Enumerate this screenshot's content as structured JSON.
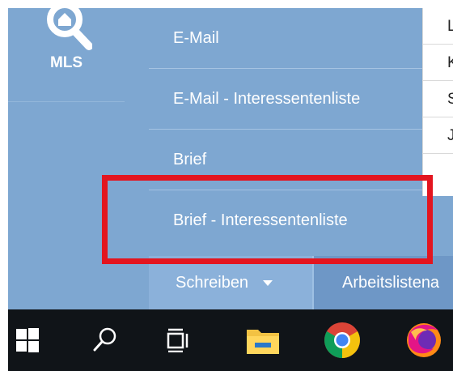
{
  "sidebar": {
    "mls_label": "MLS",
    "mls_icon": "search-home-icon"
  },
  "dropdown": {
    "items": [
      {
        "label": "E-Mail"
      },
      {
        "label": "E-Mail - Interessentenliste"
      },
      {
        "label": "Brief"
      },
      {
        "label": "Brief - Interessentenliste",
        "highlighted": true
      }
    ]
  },
  "table_peek": {
    "rows": [
      "L",
      "K",
      "S",
      "J"
    ]
  },
  "tabs": [
    {
      "label": "Schreiben",
      "icon": "caret-down-icon",
      "active": true
    },
    {
      "label": "Arbeitslistena"
    }
  ],
  "taskbar": {
    "icons": [
      "windows-start-icon",
      "search-icon",
      "task-view-icon",
      "file-explorer-icon",
      "chrome-icon",
      "firefox-icon"
    ]
  },
  "colors": {
    "panel": "#7ea7d1",
    "highlight": "#e3151f",
    "taskbar": "#101418"
  }
}
